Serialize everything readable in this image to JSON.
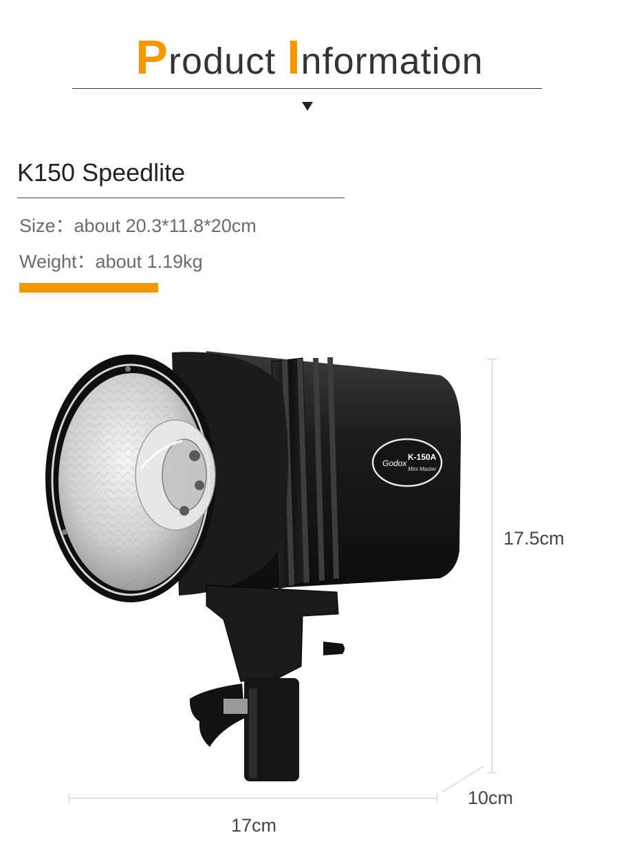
{
  "header": {
    "title_initial_1": "P",
    "title_rest_1": "roduct ",
    "title_initial_2": "I",
    "title_rest_2": "nformation",
    "arrow_icon": "triangle-down-icon",
    "accent_color": "#f39800"
  },
  "product": {
    "name": "K150 Speedlite",
    "specs": [
      {
        "label": "Size",
        "separator": "：",
        "value": "about 20.3*11.8*20cm"
      },
      {
        "label": "Weight",
        "separator": "：",
        "value": "about 1.19kg"
      }
    ]
  },
  "image": {
    "badge_brand": "Godox",
    "badge_model": "K-150A",
    "badge_sub": "Mini Master"
  },
  "dimensions": {
    "height": "17.5cm",
    "depth": "10cm",
    "width": "17cm"
  }
}
